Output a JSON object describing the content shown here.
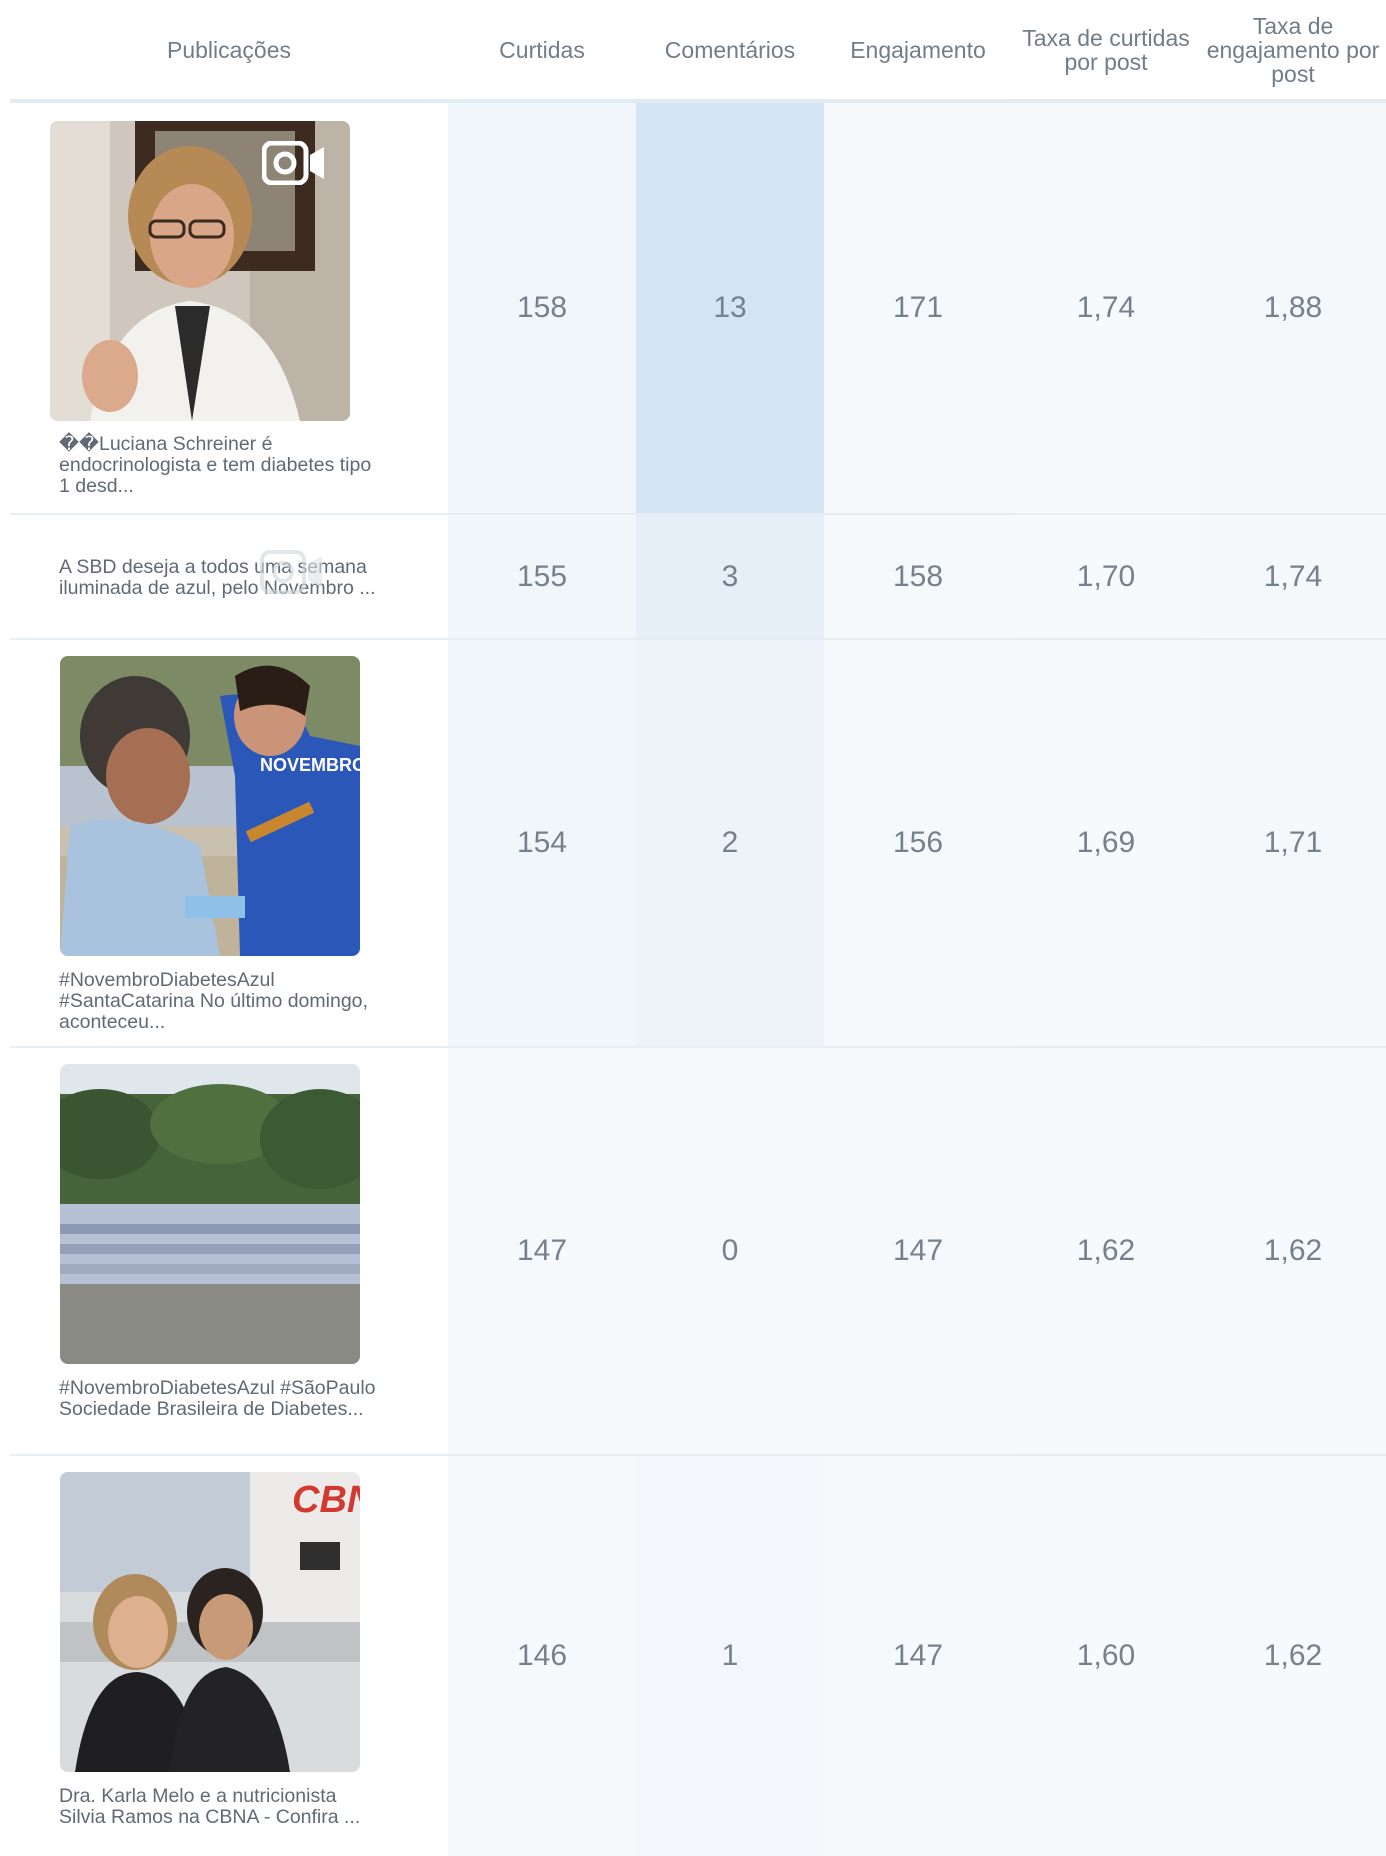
{
  "headers": {
    "publications": "Publicações",
    "likes": "Curtidas",
    "comments": "Comentários",
    "engagement": "Engajamento",
    "like_rate": "Taxa de curtidas por post",
    "engagement_rate": "Taxa de engajamento por post"
  },
  "rows": [
    {
      "caption": "��Luciana Schreiner é endocrinologista e tem diabetes tipo 1 desd...",
      "likes": "158",
      "comments": "13",
      "engagement": "171",
      "like_rate": "1,74",
      "engagement_rate": "1,88",
      "thumbnail": "woman-doctor-video",
      "media": "video-icon"
    },
    {
      "caption": "A SBD deseja a todos uma semana iluminada de azul, pelo Novembro ...",
      "likes": "155",
      "comments": "3",
      "engagement": "158",
      "like_rate": "1,70",
      "engagement_rate": "1,74",
      "thumbnail": "none",
      "media": "video-icon"
    },
    {
      "caption": "#NovembroDiabetesAzul #SantaCatarina No último domingo, aconteceu...",
      "likes": "154",
      "comments": "2",
      "engagement": "156",
      "like_rate": "1,69",
      "engagement_rate": "1,71",
      "thumbnail": "blood-glucose-test-outdoors"
    },
    {
      "caption": "#NovembroDiabetesAzul #SãoPaulo Sociedade Brasileira de Diabetes...",
      "likes": "147",
      "comments": "0",
      "engagement": "147",
      "like_rate": "1,62",
      "engagement_rate": "1,62",
      "thumbnail": "group-photo-park"
    },
    {
      "caption": "Dra. Karla Melo e a nutricionista Silvia Ramos na CBNA - Confira ...",
      "likes": "146",
      "comments": "1",
      "engagement": "147",
      "like_rate": "1,60",
      "engagement_rate": "1,62",
      "thumbnail": "radio-studio-cbn"
    }
  ],
  "colors": {
    "col_likes": "#f1f6fa",
    "col_comments_heat": [
      "#d3e4f2",
      "#e6eff7",
      "#edf3f9",
      "#f6f9fc",
      "#f6f9fc"
    ],
    "col_default": "#f6f9fc",
    "divider": "#e3ebf2"
  }
}
